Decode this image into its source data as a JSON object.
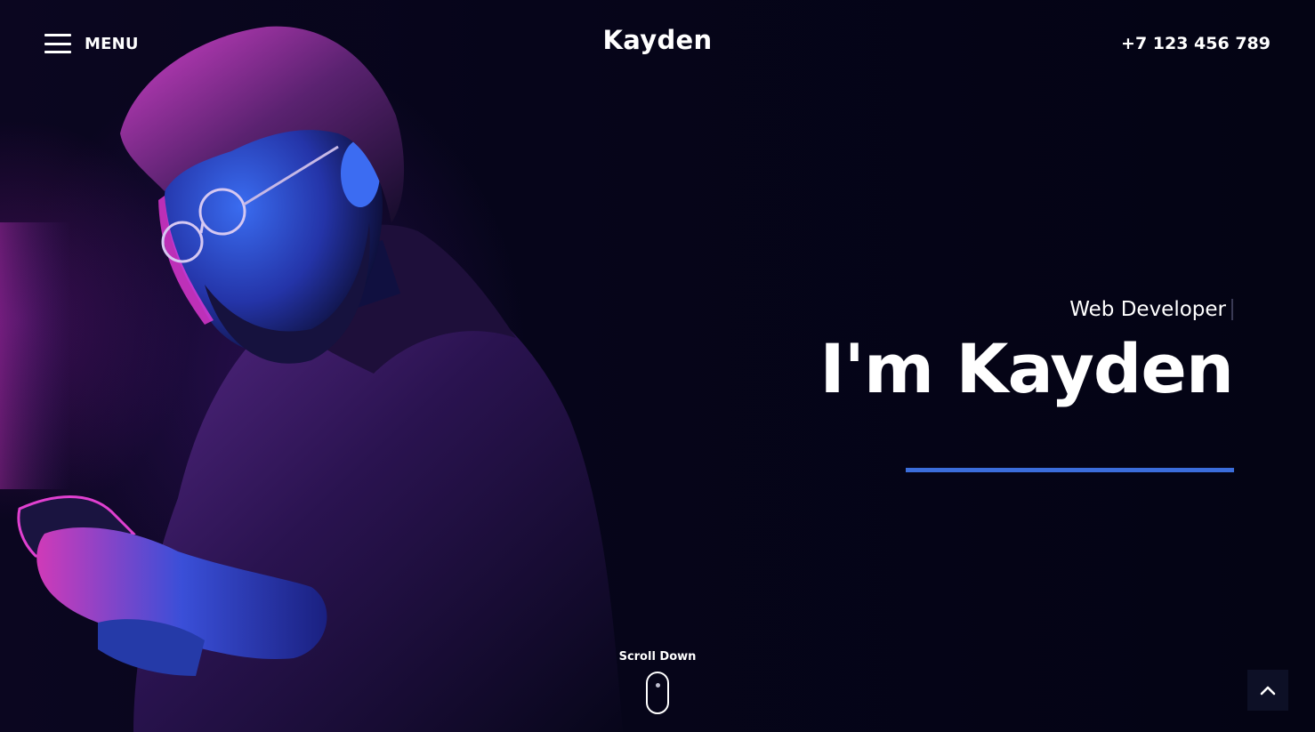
{
  "header": {
    "menu_label": "MENU",
    "logo": "Kayden",
    "phone": "+7 123 456 789"
  },
  "hero": {
    "role": "Web Developer",
    "title": "I'm Kayden",
    "accent_color": "#3b6ddb"
  },
  "scroll": {
    "label": "Scroll Down"
  },
  "icons": {
    "menu": "hamburger-icon",
    "mouse": "mouse-scroll-icon",
    "back_to_top": "chevron-up-icon"
  }
}
